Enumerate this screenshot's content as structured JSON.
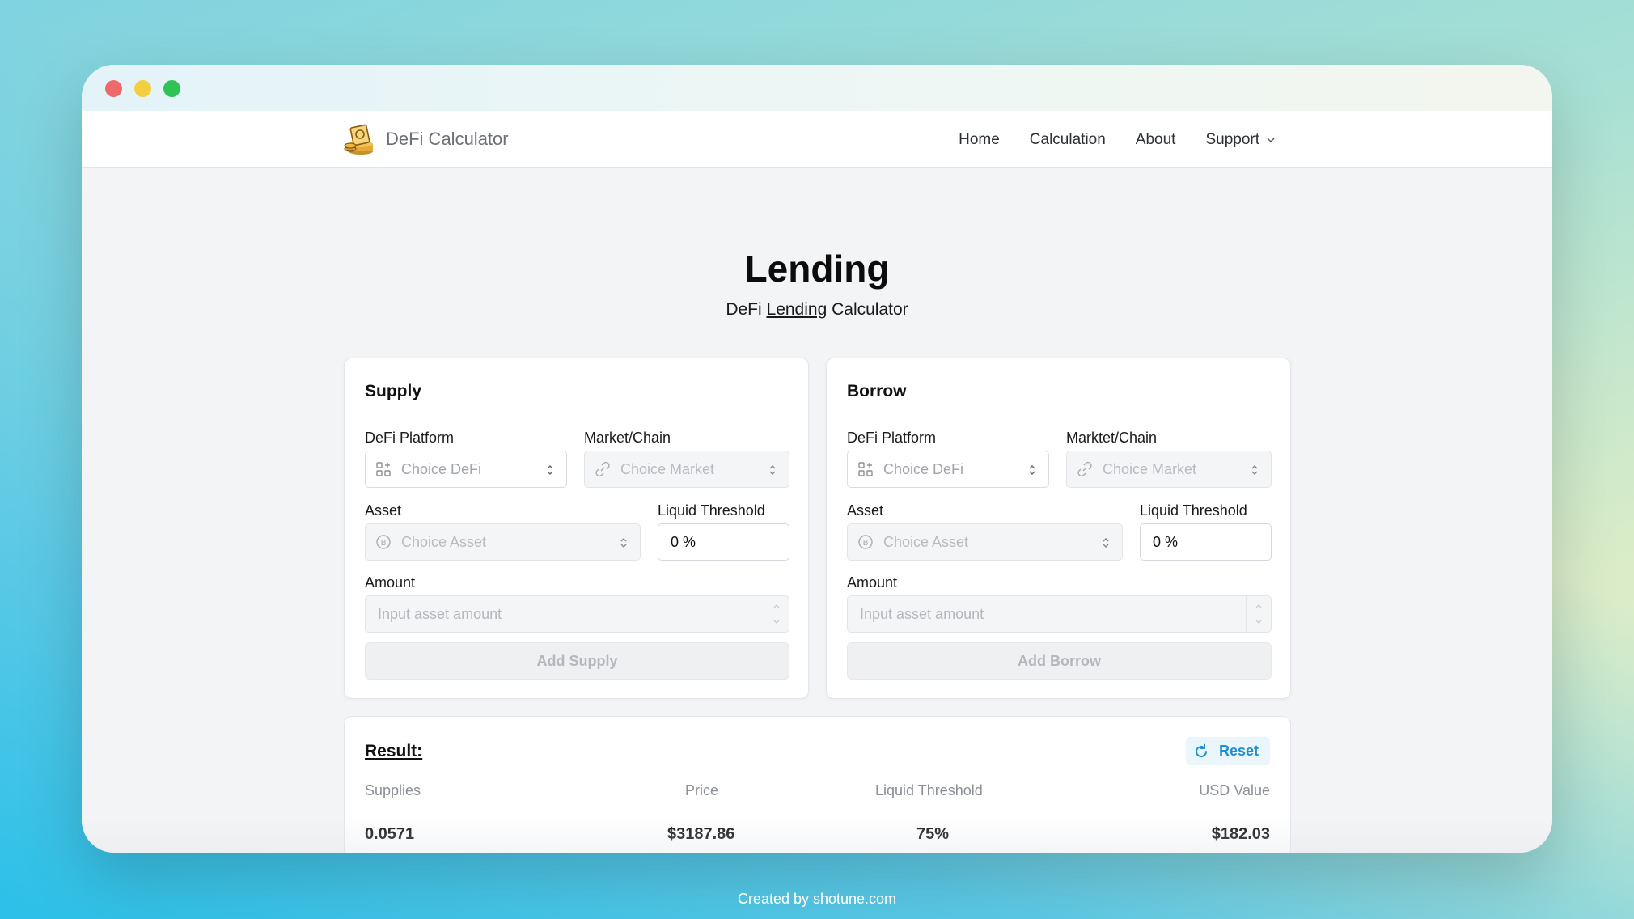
{
  "app": {
    "brand_name": "DeFi Calculator",
    "nav": [
      "Home",
      "Calculation",
      "About",
      "Support"
    ]
  },
  "hero": {
    "title": "Lending",
    "subtitle_prefix": "DeFi ",
    "subtitle_link": "Lending",
    "subtitle_suffix": " Calculator"
  },
  "supply": {
    "title": "Supply",
    "platform_label": "DeFi Platform",
    "platform_placeholder": "Choice DeFi",
    "market_label": "Market/Chain",
    "market_placeholder": "Choice Market",
    "asset_label": "Asset",
    "asset_placeholder": "Choice Asset",
    "threshold_label": "Liquid Threshold",
    "threshold_value": "0 %",
    "amount_label": "Amount",
    "amount_placeholder": "Input asset amount",
    "button": "Add Supply"
  },
  "borrow": {
    "title": "Borrow",
    "platform_label": "DeFi Platform",
    "platform_placeholder": "Choice DeFi",
    "market_label": "Marktet/Chain",
    "market_placeholder": "Choice Market",
    "asset_label": "Asset",
    "asset_placeholder": "Choice Asset",
    "threshold_label": "Liquid Threshold",
    "threshold_value": "0 %",
    "amount_label": "Amount",
    "amount_placeholder": "Input asset amount",
    "button": "Add Borrow"
  },
  "result": {
    "title": "Result:",
    "reset_label": "Reset",
    "columns": [
      "Supplies",
      "Price",
      "Liquid Threshold",
      "USD Value"
    ],
    "rows": [
      [
        "0.0571",
        "$3187.86",
        "75%",
        "$182.03"
      ]
    ]
  },
  "footer": "Created by shotune.com",
  "colors": {
    "accent": "#1d8fd2",
    "traffic_red": "#ee6a6a",
    "traffic_yellow": "#f3cf3d",
    "traffic_green": "#2fc257"
  }
}
